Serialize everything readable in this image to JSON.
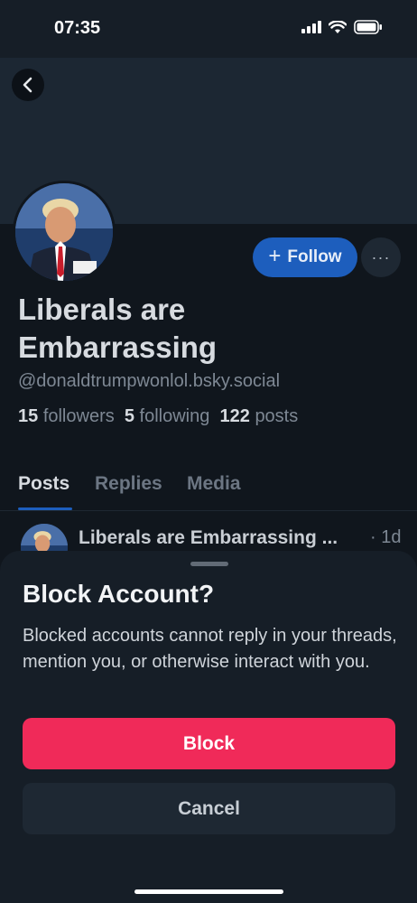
{
  "status_bar": {
    "time": "07:35"
  },
  "profile": {
    "display_name": "Liberals are Embarrassing",
    "handle": "@donaldtrumpwonlol.bsky.social",
    "followers_count": "15",
    "followers_label": "followers",
    "following_count": "5",
    "following_label": "following",
    "posts_count": "122",
    "posts_label": "posts",
    "follow_label": "Follow",
    "more_label": "···"
  },
  "tabs": [
    {
      "label": "Posts",
      "active": true
    },
    {
      "label": "Replies",
      "active": false
    },
    {
      "label": "Media",
      "active": false
    }
  ],
  "post": {
    "author": "Liberals are Embarrassing ...",
    "time": "· 1d"
  },
  "sheet": {
    "title": "Block Account?",
    "body": "Blocked accounts cannot reply in your threads, mention you, or otherwise interact with you.",
    "block_label": "Block",
    "cancel_label": "Cancel"
  },
  "colors": {
    "accent": "#1d5ebd",
    "danger": "#f02a59",
    "background": "#161e27"
  },
  "icons": [
    "back-arrow-icon",
    "signal-icon",
    "wifi-icon",
    "battery-icon",
    "plus-icon",
    "more-icon"
  ]
}
